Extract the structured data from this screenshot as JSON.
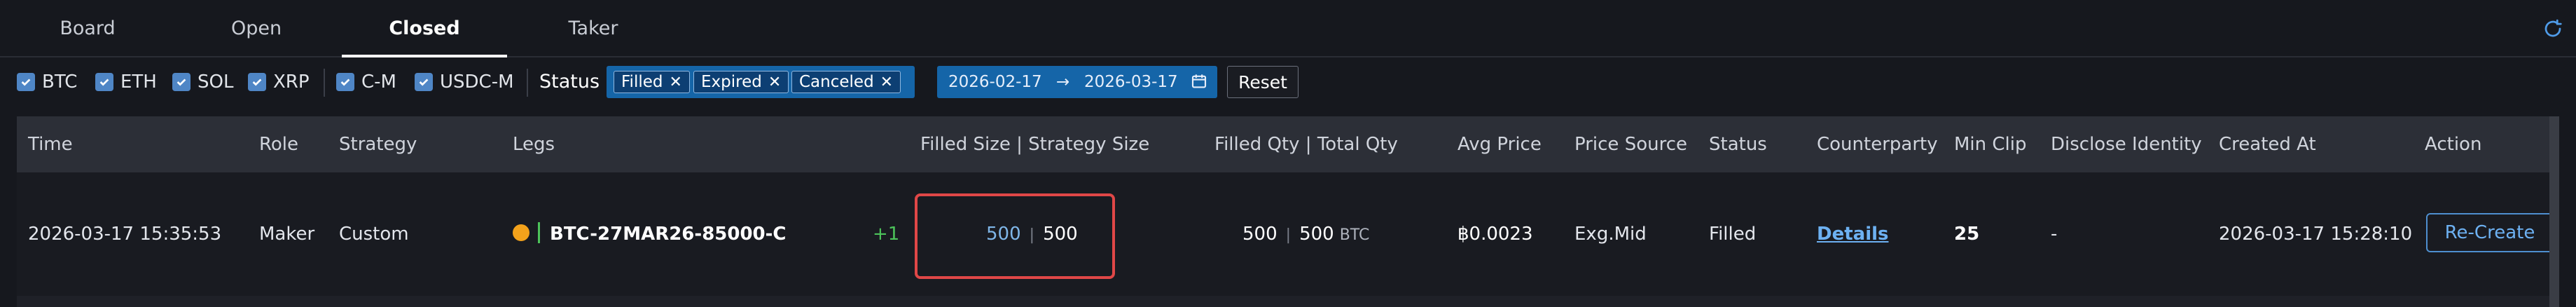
{
  "tabs": [
    {
      "label": "Board"
    },
    {
      "label": "Open"
    },
    {
      "label": "Closed",
      "active": true
    },
    {
      "label": "Taker"
    }
  ],
  "filters": {
    "assets": [
      {
        "label": "BTC",
        "checked": true
      },
      {
        "label": "ETH",
        "checked": true
      },
      {
        "label": "SOL",
        "checked": true
      },
      {
        "label": "XRP",
        "checked": true
      }
    ],
    "margins": [
      {
        "label": "C-M",
        "checked": true
      },
      {
        "label": "USDC-M",
        "checked": true
      }
    ],
    "status_label": "Status",
    "status_chips": [
      {
        "label": "Filled"
      },
      {
        "label": "Expired"
      },
      {
        "label": "Canceled"
      }
    ],
    "date_from": "2026-02-17",
    "date_arrow": "→",
    "date_to": "2026-03-17",
    "reset_label": "Reset"
  },
  "table": {
    "headers": {
      "time": "Time",
      "role": "Role",
      "strategy": "Strategy",
      "legs": "Legs",
      "filled_size": "Filled Size | Strategy Size",
      "filled_qty": "Filled Qty | Total Qty",
      "avg_price": "Avg Price",
      "price_source": "Price Source",
      "status": "Status",
      "counterparty": "Counterparty",
      "min_clip": "Min Clip",
      "disclose": "Disclose Identity",
      "created_at": "Created At",
      "action": "Action"
    },
    "rows": [
      {
        "time": "2026-03-17 15:35:53",
        "role": "Maker",
        "strategy": "Custom",
        "leg": "BTC-27MAR26-85000-C",
        "leg_extra": "+1",
        "filled_size": "500",
        "strategy_size": "500",
        "filled_qty": "500",
        "total_qty": "500",
        "qty_unit": "BTC",
        "avg_price": "฿0.0023",
        "price_source": "Exg.Mid",
        "status": "Filled",
        "counterparty": "Details",
        "min_clip": "25",
        "disclose": "-",
        "created_at": "2026-03-17 15:28:10",
        "action": "Re-Create"
      }
    ]
  },
  "colors": {
    "background": "#16181e",
    "accent": "#1565a8",
    "link": "#6db1f2",
    "highlight": "#e04747",
    "positive": "#4cc35a"
  }
}
